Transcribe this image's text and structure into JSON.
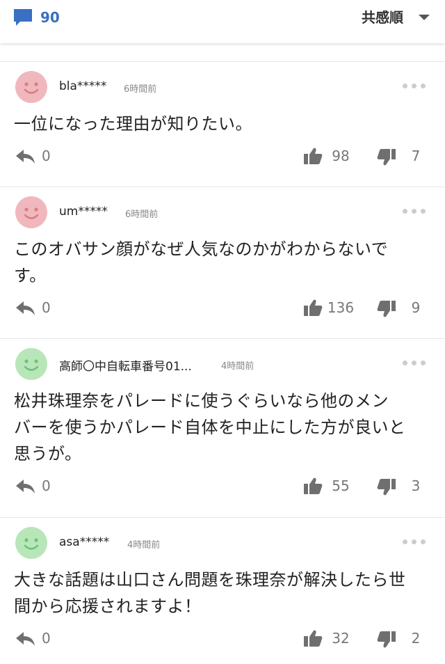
{
  "header": {
    "comment_count": "90",
    "sort_label": "共感順",
    "icons": {
      "comments": "speech-bubble-icon",
      "sort": "chevron-down-icon"
    }
  },
  "colors": {
    "accent": "#3a6fc3",
    "avatar_pink": "#f0b8bd",
    "avatar_green": "#b8e6b8",
    "icon_gray": "#6f6f6f",
    "divider": "#e6e6e6"
  },
  "comments": [
    {
      "avatar_color": "pink",
      "user": "bla*****",
      "time": "6時間前",
      "lines": [
        "一位になった理由が知りたい。"
      ],
      "replies": "0",
      "likes": "98",
      "dislikes": "7"
    },
    {
      "avatar_color": "pink",
      "user": "um*****",
      "time": "6時間前",
      "lines": [
        "このオバサン顔がなぜ人気なのかがわからないで",
        "す。"
      ],
      "replies": "0",
      "likes": "136",
      "dislikes": "9"
    },
    {
      "avatar_color": "green",
      "user": "高師〇中自転車番号01...",
      "time": "4時間前",
      "lines": [
        "松井珠理奈をパレードに使うぐらいなら他のメン",
        "バーを使うかパレード自体を中止にした方が良いと",
        "思うが。"
      ],
      "replies": "0",
      "likes": "55",
      "dislikes": "3"
    },
    {
      "avatar_color": "green",
      "user": "asa*****",
      "time": "4時間前",
      "lines": [
        "大きな話題は山口さん問題を珠理奈が解決したら世",
        "間から応援されますよ！"
      ],
      "replies": "0",
      "likes": "32",
      "dislikes": "2"
    }
  ]
}
